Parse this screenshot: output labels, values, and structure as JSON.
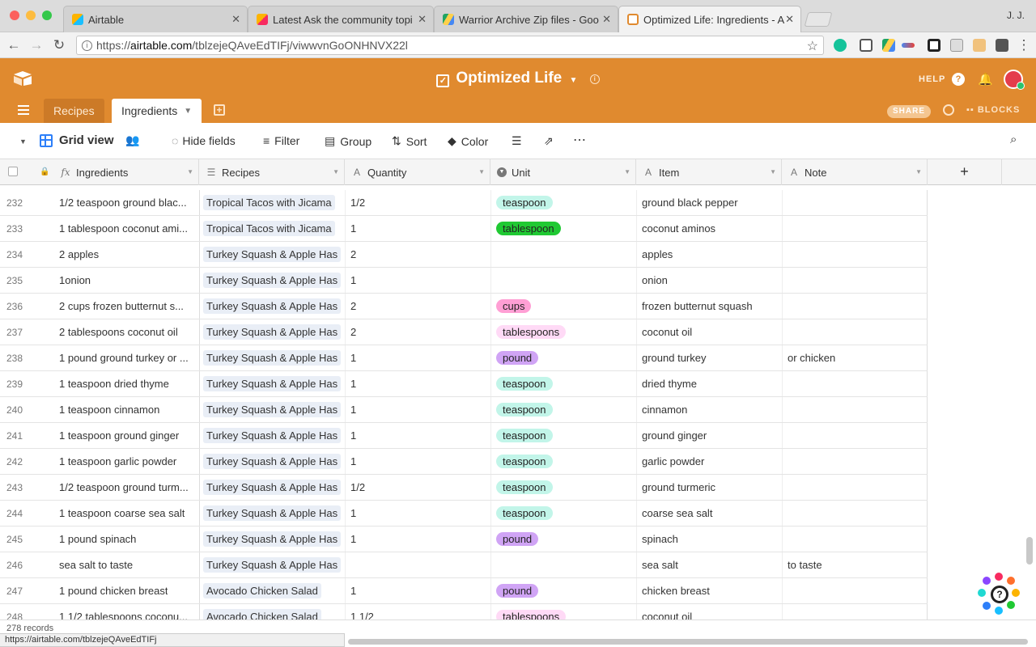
{
  "browser": {
    "tabs": [
      {
        "title": "Airtable",
        "active": false
      },
      {
        "title": "Latest Ask the community topi",
        "active": false
      },
      {
        "title": "Warrior Archive Zip files - Goo",
        "active": false
      },
      {
        "title": "Optimized Life: Ingredients - A",
        "active": true
      }
    ],
    "user": "J. J.",
    "url_prefix": "https://",
    "url_host": "airtable.com",
    "url_path": "/tblzejeQAveEdTIFj/viwwvnGoONHNVX22l",
    "status_url": "https://airtable.com/tblzejeQAveEdTIFj"
  },
  "app": {
    "base_title": "Optimized Life",
    "help": "HELP",
    "share": "SHARE",
    "blocks": "BLOCKS",
    "tables": [
      "Recipes",
      "Ingredients"
    ],
    "active_table": "Ingredients",
    "accent": "#e08a2f"
  },
  "viewbar": {
    "view_name": "Grid view",
    "hide_fields": "Hide fields",
    "filter": "Filter",
    "group": "Group",
    "sort": "Sort",
    "color": "Color"
  },
  "columns": {
    "ingredients": "Ingredients",
    "recipes": "Recipes",
    "quantity": "Quantity",
    "unit": "Unit",
    "item": "Item",
    "note": "Note"
  },
  "rows": [
    {
      "num": "232",
      "ingredient": "1/2 teaspoon ground blac...",
      "recipe": "Tropical Tacos with Jicama",
      "qty": "1/2",
      "unit": "teaspoon",
      "item": "ground black pepper",
      "note": ""
    },
    {
      "num": "233",
      "ingredient": "1 tablespoon coconut ami...",
      "recipe": "Tropical Tacos with Jicama",
      "qty": "1",
      "unit": "tablespoon",
      "item": "coconut aminos",
      "note": ""
    },
    {
      "num": "234",
      "ingredient": "2 apples",
      "recipe": "Turkey Squash & Apple Has",
      "qty": "2",
      "unit": "",
      "item": "apples",
      "note": ""
    },
    {
      "num": "235",
      "ingredient": "1onion",
      "recipe": "Turkey Squash & Apple Has",
      "qty": "1",
      "unit": "",
      "item": "onion",
      "note": ""
    },
    {
      "num": "236",
      "ingredient": "2 cups frozen butternut s...",
      "recipe": "Turkey Squash & Apple Has",
      "qty": "2",
      "unit": "cups",
      "item": "frozen butternut squash",
      "note": ""
    },
    {
      "num": "237",
      "ingredient": "2 tablespoons coconut oil",
      "recipe": "Turkey Squash & Apple Has",
      "qty": "2",
      "unit": "tablespoons",
      "item": "coconut oil",
      "note": ""
    },
    {
      "num": "238",
      "ingredient": "1 pound ground turkey or ...",
      "recipe": "Turkey Squash & Apple Has",
      "qty": "1",
      "unit": "pound",
      "item": "ground turkey",
      "note": "or chicken"
    },
    {
      "num": "239",
      "ingredient": "1 teaspoon dried thyme",
      "recipe": "Turkey Squash & Apple Has",
      "qty": "1",
      "unit": "teaspoon",
      "item": "dried thyme",
      "note": ""
    },
    {
      "num": "240",
      "ingredient": "1 teaspoon cinnamon",
      "recipe": "Turkey Squash & Apple Has",
      "qty": "1",
      "unit": "teaspoon",
      "item": "cinnamon",
      "note": ""
    },
    {
      "num": "241",
      "ingredient": "1 teaspoon ground ginger",
      "recipe": "Turkey Squash & Apple Has",
      "qty": "1",
      "unit": "teaspoon",
      "item": "ground ginger",
      "note": ""
    },
    {
      "num": "242",
      "ingredient": "1 teaspoon garlic powder",
      "recipe": "Turkey Squash & Apple Has",
      "qty": "1",
      "unit": "teaspoon",
      "item": "garlic powder",
      "note": ""
    },
    {
      "num": "243",
      "ingredient": "1/2 teaspoon ground turm...",
      "recipe": "Turkey Squash & Apple Has",
      "qty": "1/2",
      "unit": "teaspoon",
      "item": "ground turmeric",
      "note": ""
    },
    {
      "num": "244",
      "ingredient": "1 teaspoon coarse sea salt",
      "recipe": "Turkey Squash & Apple Has",
      "qty": "1",
      "unit": "teaspoon",
      "item": "coarse sea salt",
      "note": ""
    },
    {
      "num": "245",
      "ingredient": "1 pound spinach",
      "recipe": "Turkey Squash & Apple Has",
      "qty": "1",
      "unit": "pound",
      "item": "spinach",
      "note": ""
    },
    {
      "num": "246",
      "ingredient": "sea salt to taste",
      "recipe": "Turkey Squash & Apple Has",
      "qty": "",
      "unit": "",
      "item": "sea salt",
      "note": "to taste"
    },
    {
      "num": "247",
      "ingredient": "1 pound chicken breast",
      "recipe": "Avocado Chicken Salad",
      "qty": "1",
      "unit": "pound",
      "item": "chicken breast",
      "note": ""
    },
    {
      "num": "248",
      "ingredient": "1 1/2 tablespoons coconu...",
      "recipe": "Avocado Chicken Salad",
      "qty": "1 1/2",
      "unit": "tablespoons",
      "item": "coconut oil",
      "note": ""
    }
  ],
  "unit_colors": {
    "teaspoon": "#c2f5e9",
    "tablespoon": "#20c933",
    "cups": "#ff9fd4",
    "tablespoons": "#ffdaf6",
    "pound": "#d0a4f5"
  },
  "footer": {
    "record_count": "278 records"
  }
}
